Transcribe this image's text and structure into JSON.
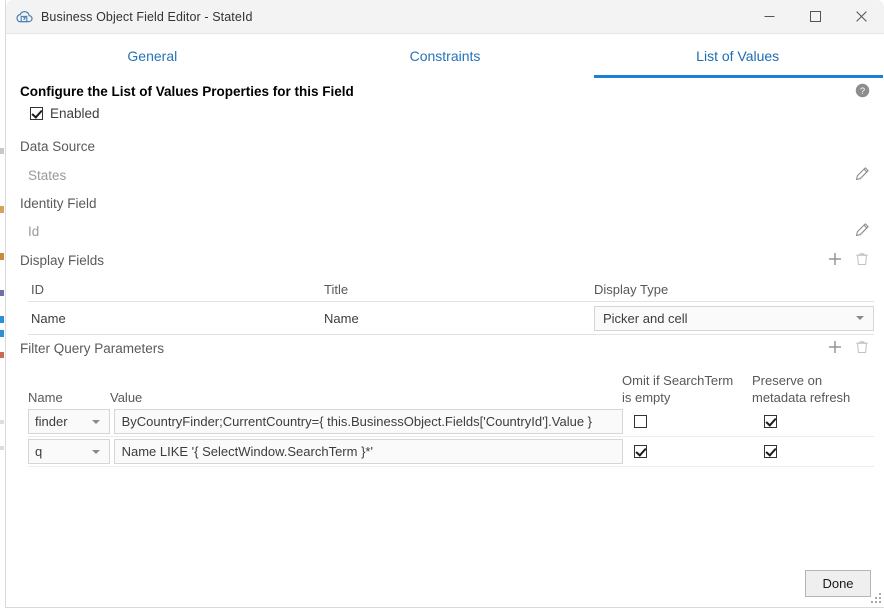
{
  "window": {
    "title": "Business Object Field Editor - StateId",
    "app_icon": "cloud-icon",
    "minimize_label": "minimize-icon",
    "maximize_label": "maximize-icon",
    "close_label": "close-icon"
  },
  "tabs": [
    {
      "label": "General",
      "active": false
    },
    {
      "label": "Constraints",
      "active": false
    },
    {
      "label": "List of Values",
      "active": true
    }
  ],
  "content": {
    "headline": "Configure the List of Values Properties for this Field",
    "help_icon": "help-icon",
    "enabled": {
      "label": "Enabled",
      "checked": true
    },
    "properties": [
      {
        "label": "Data Source",
        "value": "States",
        "edit_icon": "pencil-icon"
      },
      {
        "label": "Identity Field",
        "value": "Id",
        "edit_icon": "pencil-icon"
      }
    ],
    "display_fields": {
      "section_label": "Display Fields",
      "add_icon": "plus-icon",
      "delete_icon": "trash-icon",
      "columns": [
        "ID",
        "Title",
        "Display Type"
      ],
      "rows": [
        {
          "id": "Name",
          "title": "Name",
          "display_type": "Picker and cell"
        }
      ]
    },
    "filter_query_parameters": {
      "section_label": "Filter Query Parameters",
      "add_icon": "plus-icon",
      "delete_icon": "trash-icon",
      "columns": {
        "name": "Name",
        "value": "Value",
        "omit_line1": "Omit if SearchTerm",
        "omit_line2": "is empty",
        "preserve_line1": "Preserve on",
        "preserve_line2": "metadata refresh"
      },
      "rows": [
        {
          "name": "finder",
          "value": "ByCountryFinder;CurrentCountry={ this.BusinessObject.Fields['CountryId'].Value }",
          "omit_if_empty": false,
          "preserve_on_refresh": true
        },
        {
          "name": "q",
          "value": "Name LIKE '{ SelectWindow.SearchTerm }*'",
          "omit_if_empty": true,
          "preserve_on_refresh": true
        }
      ]
    }
  },
  "footer": {
    "done_label": "Done",
    "resize_grip": "resize-grip-icon"
  },
  "colors": {
    "accent": "#1b7fd4",
    "tab_text": "#2573b8",
    "titlebar_bg": "#f3f3f3",
    "label_gray": "#5a5a5a",
    "value_gray": "#9a9a9a"
  }
}
